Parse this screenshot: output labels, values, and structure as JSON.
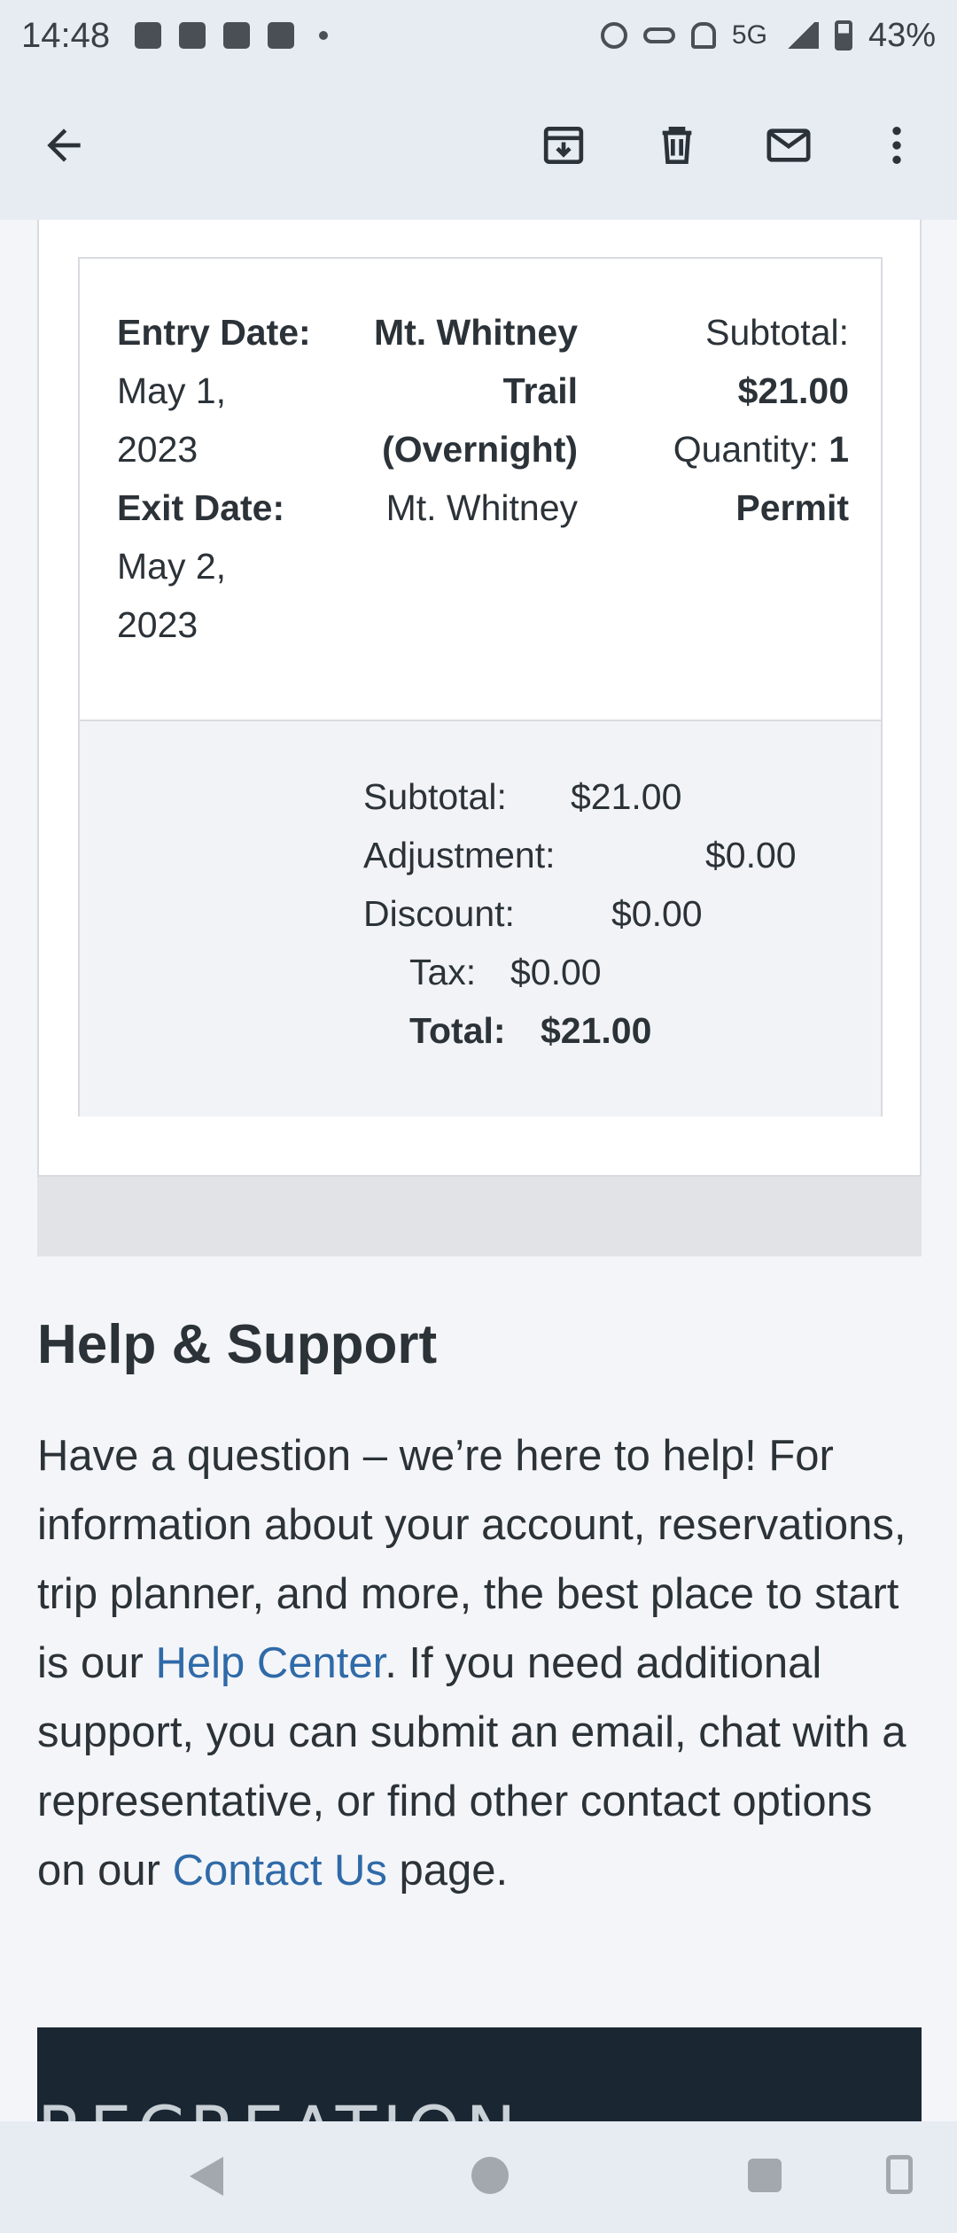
{
  "status_bar": {
    "time": "14:48",
    "network": "5G",
    "battery": "43%"
  },
  "app_bar": {
    "back_icon": "arrow-left-icon",
    "archive_icon": "archive-icon",
    "delete_icon": "trash-icon",
    "mark_unread_icon": "mail-icon",
    "more_icon": "more-vert-icon"
  },
  "order_item": {
    "entry_label": "Entry Date:",
    "entry_date_line1": "May 1,",
    "entry_date_line2": "2023",
    "exit_label": "Exit Date:",
    "exit_date_line1": "May 2,",
    "exit_date_line2": "2023",
    "permit_name_line1": "Mt. Whitney",
    "permit_name_line2": "Trail",
    "permit_name_line3": "(Overnight)",
    "location": "Mt. Whitney",
    "subtotal_label": "Subtotal:",
    "subtotal_value": "$21.00",
    "quantity_label": "Quantity:",
    "quantity_value": "1",
    "unit": "Permit"
  },
  "totals": {
    "subtotal_label": "Subtotal:",
    "subtotal_value": "$21.00",
    "adjustment_label": "Adjustment:",
    "adjustment_value": "$0.00",
    "discount_label": "Discount:",
    "discount_value": "$0.00",
    "tax_label": "Tax:",
    "tax_value": "$0.00",
    "total_label": "Total:",
    "total_value": "$21.00"
  },
  "help": {
    "title": "Help & Support",
    "text_1": "Have a question – we’re here to help! For information about your account, reservations, trip planner, and more, the best place to start is our ",
    "link_help_center": "Help Center",
    "text_2": ". If you need additional support, you can submit an email, chat with a representative, or find other contact options on our ",
    "link_contact_us": "Contact Us",
    "text_3": " page."
  },
  "footer": {
    "logo_text": "RECREATION"
  },
  "colors": {
    "link": "#2f6aa8",
    "footer_bg": "#1a2733",
    "app_bar_bg": "#e7ebf2"
  }
}
